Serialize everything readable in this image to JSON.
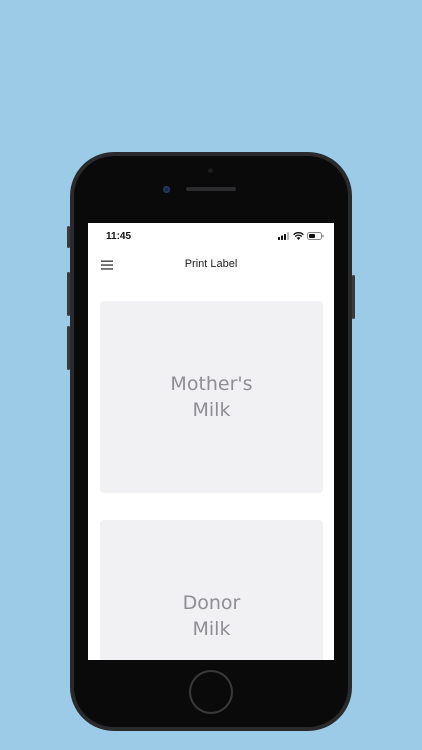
{
  "status_bar": {
    "time": "11:45",
    "icons": [
      "cellular-signal-icon",
      "wifi-icon",
      "battery-icon"
    ]
  },
  "nav": {
    "title": "Print Label",
    "menu_icon": "hamburger-menu-icon"
  },
  "cards": [
    {
      "label": "Mother's\nMilk"
    },
    {
      "label": "Donor\nMilk"
    }
  ],
  "colors": {
    "background": "#9ccbe7",
    "card_background": "#f1f1f4",
    "card_text": "#8e8e93"
  }
}
